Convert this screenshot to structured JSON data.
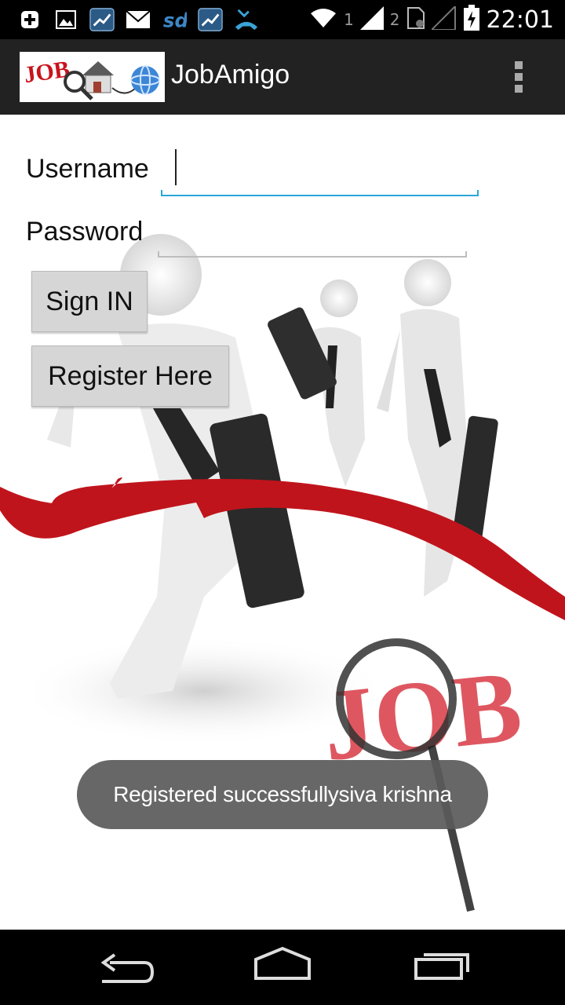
{
  "status_bar": {
    "time": "22:01",
    "sim1": "1",
    "sim2": "2",
    "icons": [
      "add-icon",
      "image-icon",
      "stocks-icon",
      "mail-icon",
      "sd-icon",
      "stocks-icon",
      "missed-call-icon",
      "wifi-icon",
      "signal-icon",
      "no-signal-icon",
      "battery-icon"
    ]
  },
  "action_bar": {
    "title": "JobAmigo",
    "logo_text": "JOB"
  },
  "form": {
    "username_label": "Username",
    "username_value": "",
    "password_label": "Password",
    "password_value": "",
    "sign_in_label": "Sign IN",
    "register_label": "Register Here"
  },
  "background": {
    "job_text": "JOB"
  },
  "toast": {
    "message": "Registered successfullysiva krishna"
  },
  "colors": {
    "focus_line": "#2aa7d8",
    "ribbon_red": "#c0141c",
    "action_bar": "#222222"
  }
}
